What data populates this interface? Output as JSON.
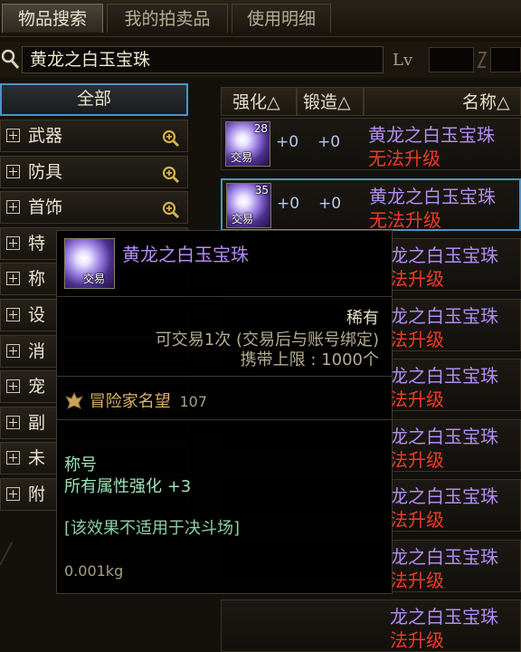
{
  "tabs": [
    {
      "label": "物品搜索",
      "active": true
    },
    {
      "label": "我的拍卖品",
      "active": false
    },
    {
      "label": "使用明细",
      "active": false
    }
  ],
  "search": {
    "value": "黄龙之白玉宝珠",
    "lv_label": "Lv",
    "lv_min": "",
    "lv_max": ""
  },
  "sidebar": {
    "all_label": "全部",
    "items": [
      {
        "label": "武器",
        "zoom": true
      },
      {
        "label": "防具",
        "zoom": true
      },
      {
        "label": "首饰",
        "zoom": true
      },
      {
        "label": "特",
        "zoom": false
      },
      {
        "label": "称",
        "zoom": false
      },
      {
        "label": "设",
        "zoom": false
      },
      {
        "label": "消",
        "zoom": false
      },
      {
        "label": "宠",
        "zoom": false
      },
      {
        "label": "副",
        "zoom": false
      },
      {
        "label": "未",
        "zoom": false
      },
      {
        "label": "附",
        "zoom": false
      }
    ]
  },
  "columns": {
    "enhance": "强化△",
    "forge": "锻造△",
    "name": "名称△"
  },
  "rows": [
    {
      "count": "28",
      "trade": "交易",
      "enhance": "+0",
      "forge": "+0",
      "name": "黄龙之白玉宝珠",
      "status": "无法升级"
    },
    {
      "count": "35",
      "trade": "交易",
      "enhance": "+0",
      "forge": "+0",
      "name": "黄龙之白玉宝珠",
      "status": "无法升级"
    },
    {
      "name": "龙之白玉宝珠",
      "status": "法升级"
    },
    {
      "name": "龙之白玉宝珠",
      "status": "法升级"
    },
    {
      "name": "龙之白玉宝珠",
      "status": "法升级"
    },
    {
      "name": "龙之白玉宝珠",
      "status": "法升级"
    },
    {
      "name": "龙之白玉宝珠",
      "status": "法升级"
    },
    {
      "name": "龙之白玉宝珠",
      "status": "法升级"
    },
    {
      "name": "龙之白玉宝珠",
      "status": "法升级"
    }
  ],
  "tooltip": {
    "trade": "交易",
    "name": "黄龙之白玉宝珠",
    "rarity": "稀有",
    "trade_limit": "可交易1次 (交易后与账号绑定)",
    "carry_limit": "携带上限 : 1000个",
    "reputation_label": "冒险家名望",
    "reputation_value": "107",
    "title_label": "称号",
    "stat": "所有属性强化 +3",
    "note": "[该效果不适用于决斗场]",
    "weight": "0.001kg"
  },
  "colors": {
    "rare_purple": "#b28cf2",
    "red_status": "#f03a2a",
    "green_stat": "#9fe3b8",
    "accent_blue": "#4e93c6"
  }
}
